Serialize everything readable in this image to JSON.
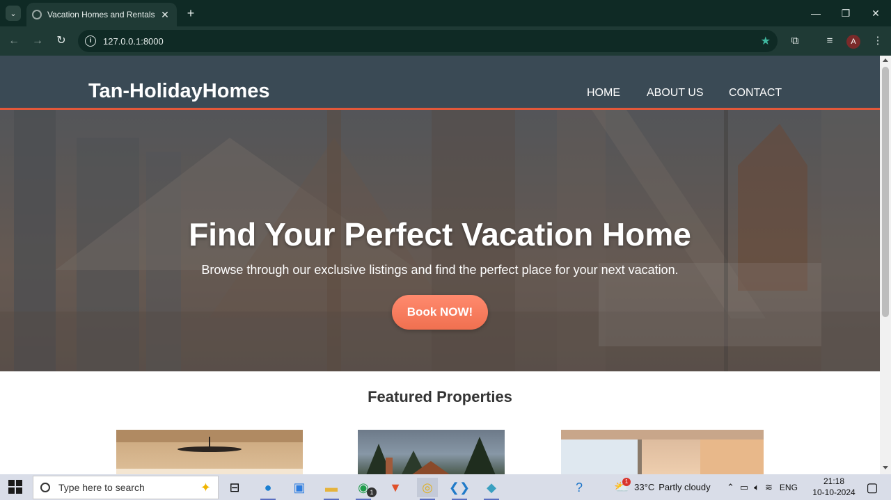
{
  "browser": {
    "tab_title": "Vacation Homes and Rentals",
    "url": "127.0.0.1:8000",
    "profile_initial": "A",
    "accent_color": "#3fb8a0"
  },
  "site": {
    "logo": "Tan-HolidayHomes",
    "nav": [
      "HOME",
      "ABOUT US",
      "CONTACT"
    ],
    "header_color": "#3a4a55",
    "header_border_color": "#e2583a"
  },
  "hero": {
    "title": "Find Your Perfect Vacation Home",
    "subtitle": "Browse through our exclusive listings and find the perfect place for your next vacation.",
    "cta_label": "Book NOW!",
    "cta_color": "#f07050"
  },
  "featured": {
    "title": "Featured Properties"
  },
  "taskbar": {
    "search_placeholder": "Type here to search",
    "weather_temp": "33°C",
    "weather_text": "Partly cloudy",
    "language": "ENG",
    "time": "21:18",
    "date": "10-10-2024",
    "whatsapp_badge": "1",
    "weather_badge": "1"
  }
}
